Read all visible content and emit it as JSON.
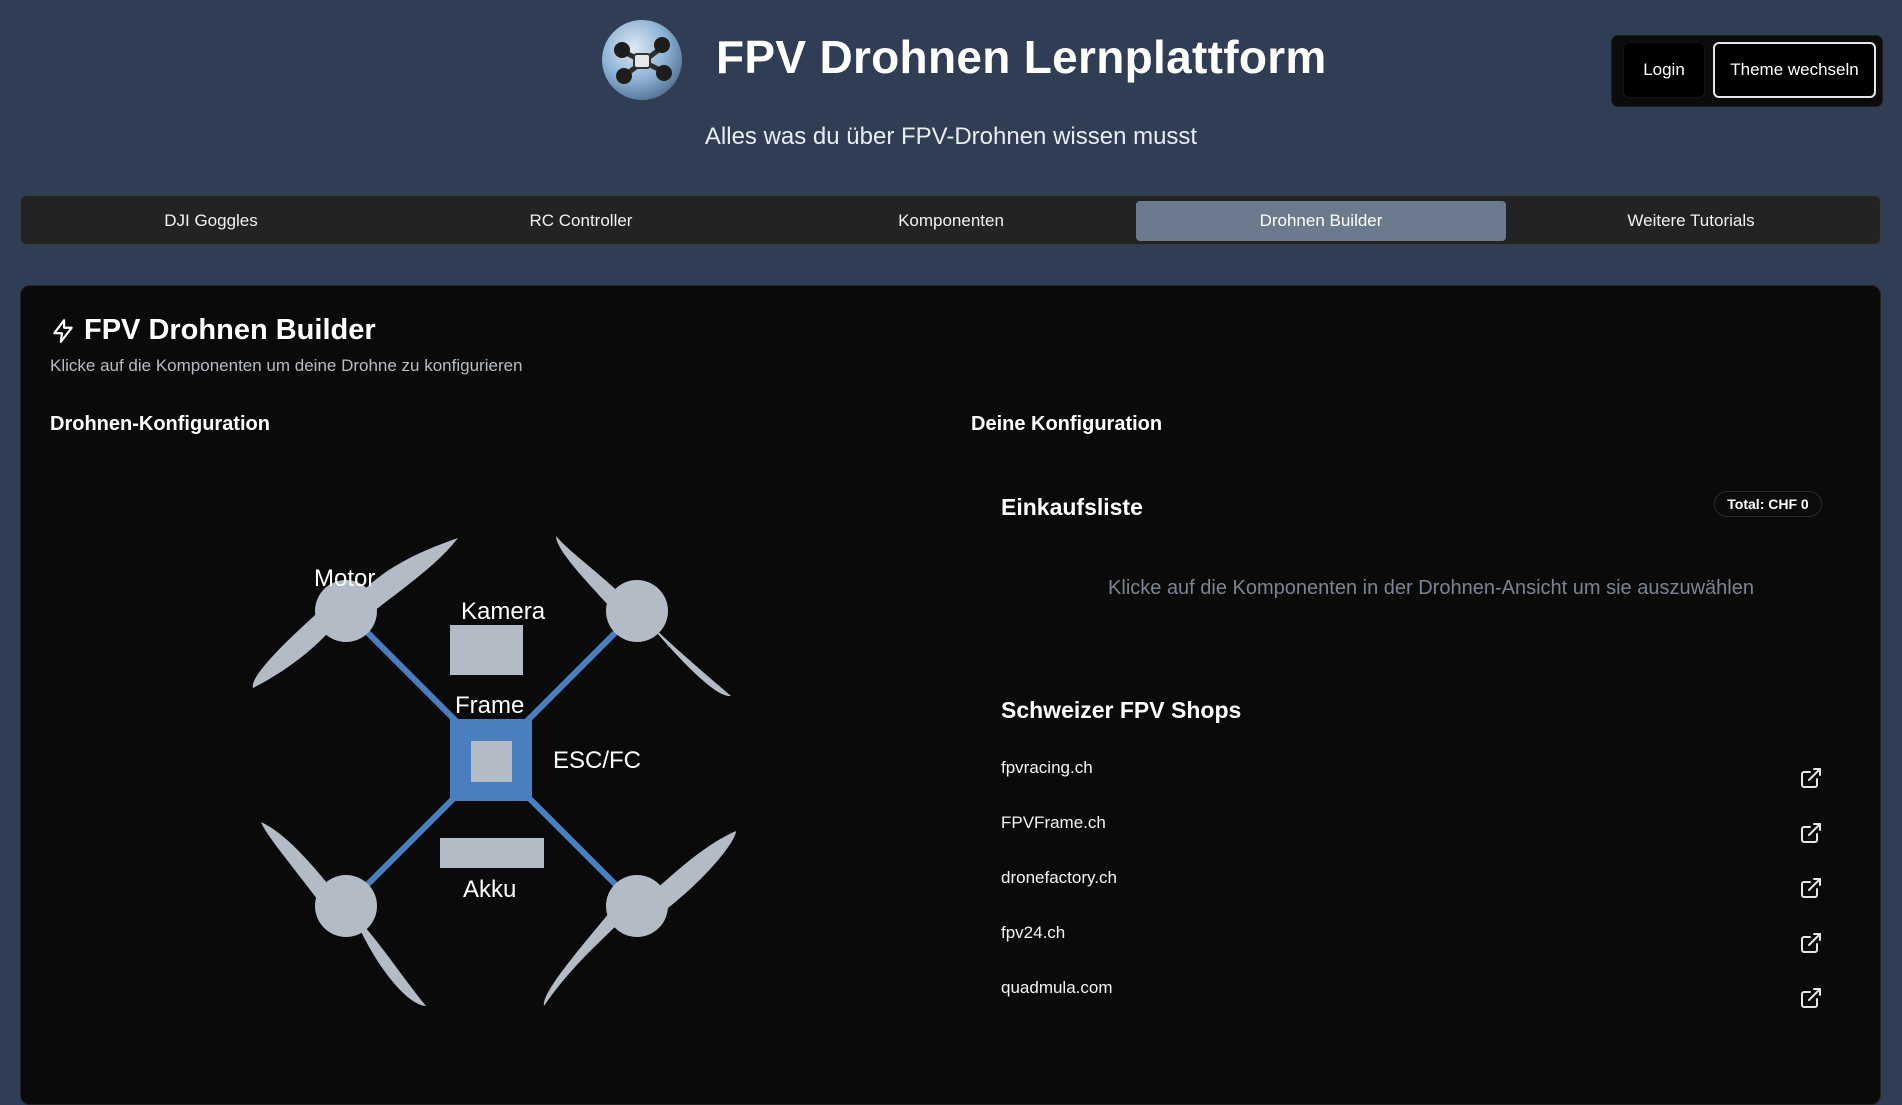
{
  "header": {
    "title": "FPV Drohnen Lernplattform",
    "subtitle": "Alles was du über FPV-Drohnen wissen musst",
    "login_label": "Login",
    "theme_label": "Theme wechseln"
  },
  "tabs": [
    {
      "label": "DJI Goggles"
    },
    {
      "label": "RC Controller"
    },
    {
      "label": "Komponenten"
    },
    {
      "label": "Drohnen Builder",
      "active": true
    },
    {
      "label": "Weitere Tutorials"
    }
  ],
  "builder": {
    "title": "FPV Drohnen Builder",
    "subtitle": "Klicke auf die Komponenten um deine Drohne zu konfigurieren",
    "left_heading": "Drohnen-Konfiguration",
    "right_heading": "Deine Konfiguration",
    "drone_labels": {
      "motor": "Motor",
      "kamera": "Kamera",
      "frame": "Frame",
      "esc": "ESC/FC",
      "akku": "Akku"
    },
    "einkaufsliste": {
      "title": "Einkaufsliste",
      "total": "Total: CHF 0",
      "empty_message": "Klicke auf die Komponenten in der Drohnen-Ansicht um sie auszuwählen"
    },
    "shops": {
      "title": "Schweizer FPV Shops",
      "items": [
        {
          "name": "fpvracing.ch"
        },
        {
          "name": "FPVFrame.ch"
        },
        {
          "name": "dronefactory.ch"
        },
        {
          "name": "fpv24.ch"
        },
        {
          "name": "quadmula.com"
        }
      ]
    }
  },
  "colors": {
    "page_bg": "#2f3d55",
    "card_bg": "#0a0a0a",
    "frame_blue": "#4a7fbf",
    "part_gray": "#b3bcc6",
    "active_tab": "#6b7a8c"
  },
  "icons": {
    "logo": "drone-logo-icon",
    "builder": "lightning-icon",
    "shop_link": "external-link-icon"
  }
}
